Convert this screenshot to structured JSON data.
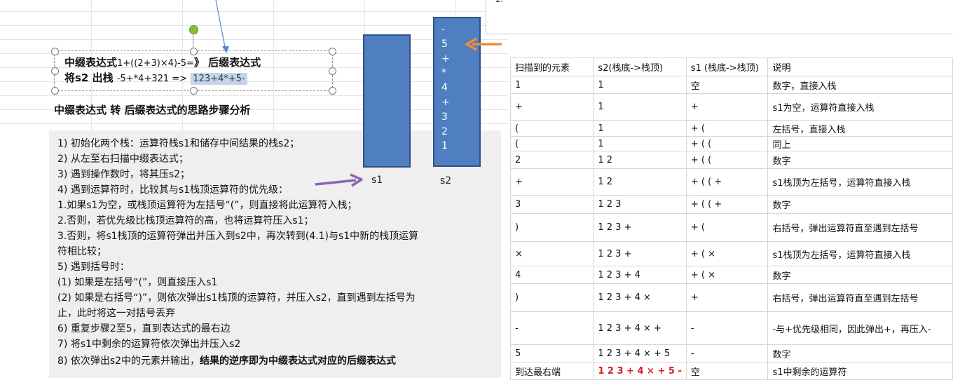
{
  "topbox": {
    "text": "1."
  },
  "textbox": {
    "line1_bold": "中缀表达式",
    "line1_expr": "1+((2+3)×4)-5=",
    "line1_arrow": "》",
    "line1_tail": "后缀表达式",
    "line2_bold": "将s2 出栈",
    "line2_expr": "-5+*4+321 =>",
    "line2_hl": "123+4*+5-"
  },
  "heading": "中缀表达式 转 后缀表达式的思路步骤分析",
  "steps": [
    "1) 初始化两个栈：运算符栈s1和储存中间结果的栈s2；",
    "2) 从左至右扫描中缀表达式；",
    "3) 遇到操作数时，将其压s2；",
    "4) 遇到运算符时，比较其与s1栈顶运算符的优先级：",
    "1.如果s1为空，或栈顶运算符为左括号“(”，则直接将此运算符入栈；",
    "2.否则，若优先级比栈顶运算符的高，也将运算符压入s1；",
    "3.否则，将s1栈顶的运算符弹出并压入到s2中，再次转到(4.1)与s1中新的栈顶运算",
    "符相比较；",
    "5) 遇到括号时：",
    "(1) 如果是左括号“(”，则直接压入s1",
    "(2) 如果是右括号“)”，则依次弹出s1栈顶的运算符，并压入s2，直到遇到左括号为",
    "止，此时将这一对括号丢弃",
    "6) 重复步骤2至5，直到表达式的最右边",
    "7) 将s1中剩余的运算符依次弹出并压入s2"
  ],
  "step8_prefix": "8)  依次弹出s2中的元素并输出，",
  "step8_bold": "结果的逆序即为中缀表达式对应的后缀表达式",
  "stacks": {
    "s1_label": "s1",
    "s2_label": "s2",
    "s2_items": [
      "-",
      "5",
      "+",
      "*",
      "4",
      "+",
      "3",
      "2",
      "1"
    ]
  },
  "table": {
    "headers": [
      "扫描到的元素",
      "s2(栈底->栈顶)",
      "s1 (栈底->栈顶)",
      "说明"
    ],
    "rows": [
      [
        "1",
        "1",
        "空",
        "数字，直接入栈"
      ],
      [
        "+",
        "1",
        "+",
        "s1为空，运算符直接入栈"
      ],
      [
        "(",
        "1",
        "+ (",
        "左括号，直接入栈"
      ],
      [
        "(",
        "1",
        "+ ( (",
        "同上"
      ],
      [
        "2",
        "1 2",
        "+ ( (",
        "数字"
      ],
      [
        "+",
        "1 2",
        "+ ( ( +",
        "s1栈顶为左括号，运算符直接入栈"
      ],
      [
        "3",
        "1 2 3",
        "+ ( ( +",
        "数字"
      ],
      [
        ")",
        "1 2 3 +",
        "+ (",
        "右括号，弹出运算符直至遇到左括号"
      ],
      [
        "×",
        "1 2 3 +",
        "+ ( ×",
        "s1栈顶为左括号，运算符直接入栈"
      ],
      [
        "4",
        "1 2 3 + 4",
        "+ ( ×",
        "数字"
      ],
      [
        ")",
        "1 2 3 + 4 ×",
        "+",
        "右括号，弹出运算符直至遇到左括号"
      ],
      [
        "-",
        "1 2 3 + 4 × +",
        "-",
        "-与+优先级相同，因此弹出+，再压入-"
      ],
      [
        "5",
        "1 2 3 + 4 × + 5",
        "-",
        "数字"
      ],
      [
        "到达最右端",
        "1 2 3 + 4 × + 5 -",
        "空",
        "s1中剩余的运算符"
      ]
    ]
  },
  "colors": {
    "stack_fill": "#4f7fc0",
    "arrow_orange": "#f08c3a",
    "arrow_purple": "#8a64b8",
    "highlight": "#c7d4e6",
    "final_red": "#d62020"
  }
}
